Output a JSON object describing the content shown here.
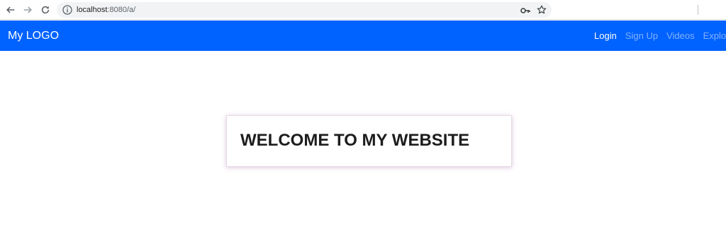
{
  "browser": {
    "url_host": "localhost",
    "url_rest": ":8080/a/"
  },
  "navbar": {
    "brand": "My LOGO",
    "links": [
      {
        "label": "Login"
      },
      {
        "label": "Sign Up"
      },
      {
        "label": "Videos"
      },
      {
        "label": "Explore"
      }
    ]
  },
  "main": {
    "heading": "WELCOME TO MY WEBSITE"
  },
  "colors": {
    "navbar": "#0062ff",
    "brand_text": "#ffffff"
  }
}
